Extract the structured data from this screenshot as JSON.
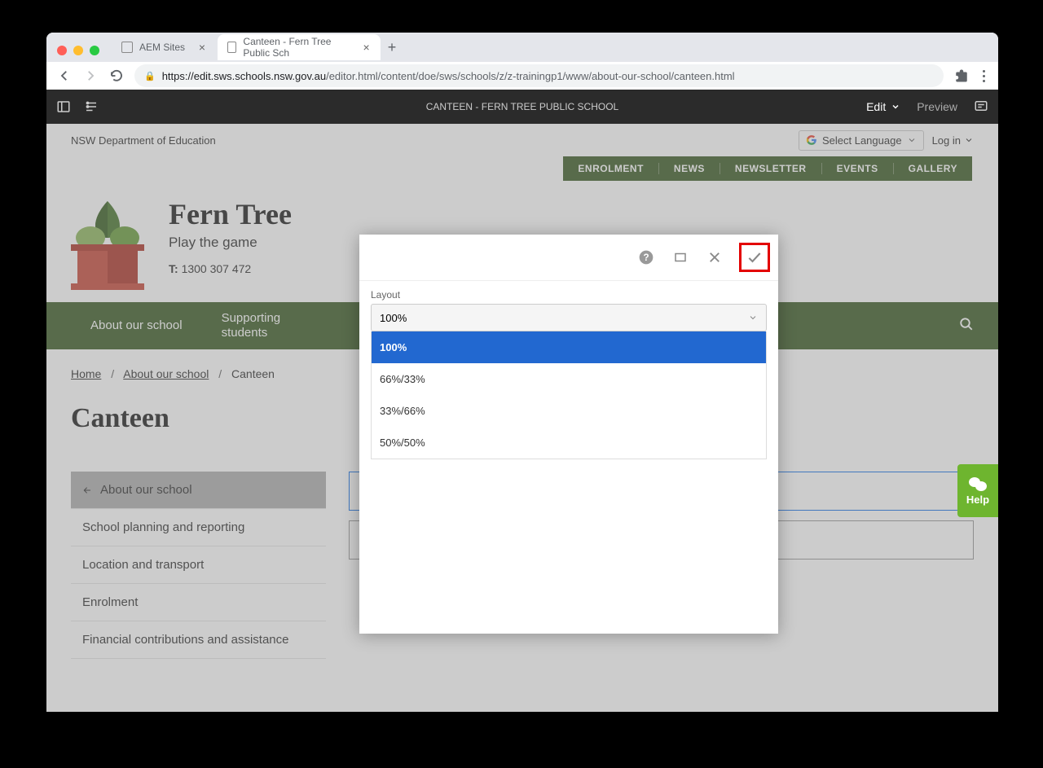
{
  "browser": {
    "tabs": [
      {
        "label": "AEM Sites"
      },
      {
        "label": "Canteen - Fern Tree Public Sch"
      }
    ],
    "url_domain": "https://edit.sws.schools.nsw.gov.au",
    "url_path": "/editor.html/content/doe/sws/schools/z/z-trainingp1/www/about-our-school/canteen.html"
  },
  "aem": {
    "title": "CANTEEN - FERN TREE PUBLIC SCHOOL",
    "mode": "Edit",
    "preview": "Preview"
  },
  "page": {
    "dept": "NSW Department of Education",
    "lang": "Select Language",
    "login": "Log in",
    "green_nav": [
      "ENROLMENT",
      "NEWS",
      "NEWSLETTER",
      "EVENTS",
      "GALLERY"
    ],
    "hero_title": "Fern Tree",
    "hero_tag": "Play the game",
    "phone_label": "T:",
    "phone_number": "1300 307 472",
    "main_nav": [
      "About our school",
      "Supporting students"
    ],
    "breadcrumb": {
      "items": [
        "Home",
        "About our school"
      ],
      "current": "Canteen"
    },
    "title": "Canteen",
    "side_nav": [
      "About our school",
      "School planning and reporting",
      "Location and transport",
      "Enrolment",
      "Financial contributions and assistance"
    ]
  },
  "dialog": {
    "field_label": "Layout",
    "selected": "100%",
    "options": [
      "100%",
      "66%/33%",
      "33%/66%",
      "50%/50%"
    ]
  },
  "help": {
    "label": "Help"
  }
}
